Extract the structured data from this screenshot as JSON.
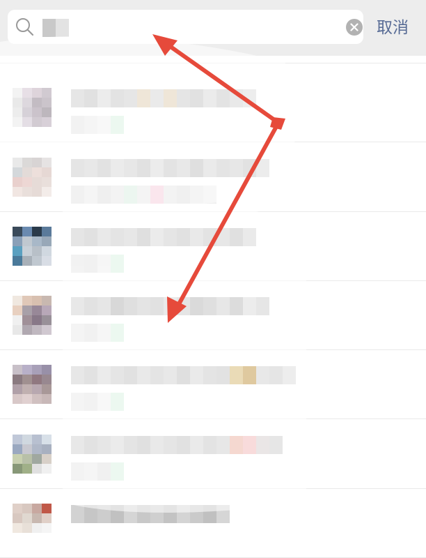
{
  "search": {
    "placeholder": "",
    "query_mosaic": [
      "#c9c9c9",
      "#e3e3e3"
    ],
    "cancel_label": "取消"
  },
  "colors": {
    "header_bg": "#ededed",
    "link": "#576b95",
    "annotation": "#e64a3b"
  },
  "results": [
    {
      "avatar": [
        "#3a3a3a",
        "#5a5a5a",
        "#2a2a2a",
        "#8a7a6a",
        "#c8c8c8",
        "#e5e5e5",
        "#b0b0b0",
        "#d8d8d8",
        "#ffffff",
        "#ffffff",
        "#ffffff",
        "#ffffff",
        "#ffffff",
        "#ffffff",
        "#ffffff",
        "#ffffff"
      ],
      "line1": [],
      "line2": [
        "#e6e6e6",
        "#e9e9e9",
        "#f0f0f0",
        "#d5f0de"
      ]
    },
    {
      "avatar": [
        "#e5e5e5",
        "#c9b8c8",
        "#b5a0b0",
        "#9a8a9a",
        "#cfcfcf",
        "#b3a8b5",
        "#7a6a7a",
        "#8d7d8d",
        "#d8d8d8",
        "#a59aa8",
        "#8c7b8c",
        "#6d5f6d",
        "#e5e5e5",
        "#c4b6c6",
        "#9c8d9c",
        "#a898a8"
      ],
      "line1": [
        "#c8c8c8",
        "#bdbdbd",
        "#d5d5d5",
        "#c0c0c0",
        "#c7c7c7",
        "#dcc8a8",
        "#d0d0d0",
        "#dcc8a8",
        "#c6c6c6",
        "#bcbcbc",
        "#d2d2d2",
        "#c1c1c1",
        "#cfcfcf",
        "#d8d8d8"
      ],
      "line2": [
        "#e3e3e3",
        "#e8e8e8",
        "#f0f0f0",
        "#d5f0de"
      ]
    },
    {
      "avatar": [
        "#cfcfcf",
        "#b0aaa8",
        "#a8a0a0",
        "#c8c0c0",
        "#a0a8b0",
        "#c0b0a8",
        "#d8b8b0",
        "#c8a8a0",
        "#d09890",
        "#d8a8a0",
        "#c8b0a8",
        "#d0b8b0",
        "#e0c8c0",
        "#d0b8b0",
        "#c8b0a8",
        "#e5d5cf"
      ],
      "line1": [
        "#c5c5c5",
        "#cccccc",
        "#bfbfbf",
        "#d2d2d2",
        "#c9c9c9",
        "#bdbdbd",
        "#d6d6d6",
        "#c2c2c2",
        "#cccccc",
        "#b8b8b8",
        "#d0d0d0",
        "#c4c4c4",
        "#cbcbcb",
        "#bfbfbf",
        "#d4d4d4"
      ],
      "line2": [
        "#e2e2e2",
        "#eaeaea",
        "#dddddd",
        "#e6e6e6",
        "#d5ecde",
        "#e8e8e8",
        "#f5c8d8",
        "#e6e6e6",
        "#dfdfdf",
        "#e8e8e8",
        "#eeeeee"
      ]
    },
    {
      "avatar": [
        "#3a4a5a",
        "#6a8ab0",
        "#2a3a4a",
        "#5a7a9a",
        "#8aa0b8",
        "#c0c8d0",
        "#a8b8c8",
        "#98a8b8",
        "#5aa0c0",
        "#c8d0d8",
        "#b8c0c8",
        "#d0d8e0",
        "#4a7a9a",
        "#a8b0b8",
        "#c0c8d0",
        "#d8dde5"
      ],
      "line1": [
        "#c7c7c7",
        "#bdbdbd",
        "#cfcfcf",
        "#c3c3c3",
        "#cbcbcb",
        "#b9b9b9",
        "#d3d3d3",
        "#c6c6c6",
        "#bebebe",
        "#d0d0d0",
        "#c2c2c2",
        "#cacaca",
        "#bcbcbc",
        "#d1d1d1"
      ],
      "line2": [
        "#e4e4e4",
        "#e0e0e0",
        "#ededed",
        "#d5f0de"
      ]
    },
    {
      "avatar": [
        "#f0e8e0",
        "#e0c8b8",
        "#d8c0b0",
        "#c8b8b0",
        "#e8d0c0",
        "#a8a0a8",
        "#988898",
        "#b8a8b8",
        "#f0f0f0",
        "#a09098",
        "#887888",
        "#989098",
        "#e8e8e8",
        "#b0a8b0",
        "#c0b8c0",
        "#d0c8d0"
      ],
      "line1": [
        "#cdcdcd",
        "#bfbfbf",
        "#c8c8c8",
        "#a8a8a8",
        "#b8b8b8",
        "#c4c4c4",
        "#bcbcbc",
        "#d0d0d0",
        "#c6c6c6",
        "#aeaeae",
        "#b8b8b8",
        "#c9c9c9",
        "#b2b2b2",
        "#d4d4d4",
        "#c8c8c8"
      ],
      "line2": [
        "#e6e6e6",
        "#e1e1e1",
        "#ececec",
        "#d5f0de"
      ]
    },
    {
      "avatar": [
        "#c8c0c8",
        "#b8b0c8",
        "#a8a0b8",
        "#9890a8",
        "#8a7a80",
        "#a09090",
        "#907880",
        "#988890",
        "#b0a0a8",
        "#c0b0b0",
        "#b8a8b0",
        "#a89898",
        "#d8c8c8",
        "#e0d0d0",
        "#d0c0c0",
        "#c8b8b8"
      ],
      "line1": [
        "#cbcbcb",
        "#bfbfbf",
        "#d2d2d2",
        "#c6c6c6",
        "#bcbcbc",
        "#cfcfcf",
        "#c3c3c3",
        "#cccccc",
        "#b9b9b9",
        "#d0d0d0",
        "#c4c4c4",
        "#bebebe",
        "#d0b060",
        "#b8882a",
        "#cdcdcd",
        "#c5c5c5",
        "#d8d8d8"
      ],
      "line2": [
        "#e6e6e6",
        "#e2e2e2",
        "#f0f0f0",
        "#d5f0de"
      ]
    },
    {
      "avatar": [
        "#c0c8d8",
        "#d0d8e0",
        "#b8c0d0",
        "#d8e0e8",
        "#9aa8c0",
        "#c8c8d0",
        "#b0b8c8",
        "#a8b0c0",
        "#c8d0b0",
        "#b8c0a8",
        "#a0a8a0",
        "#d8d0c8",
        "#889878",
        "#a0b088",
        "#e0e0e0",
        "#f0f0f0"
      ],
      "line1": [
        "#cccccc",
        "#bfbfbf",
        "#c8c8c8",
        "#d2d2d2",
        "#c4c4c4",
        "#bbbbbb",
        "#cfcfcf",
        "#c6c6c6",
        "#bdbdbd",
        "#d0d0d0",
        "#c2c2c2",
        "#cbcbcb",
        "#e8a898",
        "#f0b0b0",
        "#d0c8c8",
        "#c8c8c8"
      ],
      "line2": [
        "#e5e5e5",
        "#e8e8e8",
        "#dddddd",
        "#d5f0de"
      ]
    },
    {
      "avatar": [
        "#e0d0c8",
        "#d8c8c0",
        "#c8a8a0",
        "#c05848",
        "#d8c8c0",
        "#e0d8d0",
        "#c8b8b0",
        "#e0d0c8",
        "#f0e8e0",
        "#e8e0d8",
        "#f0f0f0",
        "#f5f5f5",
        "#ffffff",
        "#ffffff",
        "#ffffff",
        "#ffffff"
      ],
      "line1": [
        "#d2d2d2",
        "#c6c6c6",
        "#cdcdcd",
        "#c1c1c1",
        "#d5d5d5",
        "#c8c8c8",
        "#cfcfcf",
        "#c3c3c3",
        "#d4d4d4",
        "#cacaca",
        "#c0c0c0",
        "#d6d6d6"
      ],
      "line2": []
    }
  ]
}
